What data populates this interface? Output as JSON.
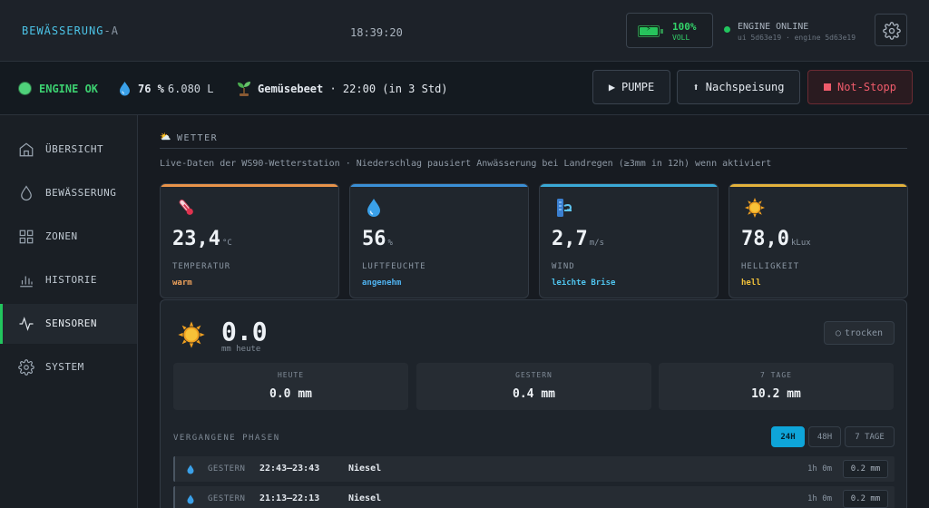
{
  "header": {
    "brand": "BEWÄSSERUNG",
    "brand_suffix": "-A",
    "clock": "18:39:20",
    "battery": {
      "percent": "100%",
      "label": "VOLL",
      "level": 1.0,
      "color": "#27c35c"
    },
    "engine": {
      "status": "ENGINE ONLINE",
      "versions": "ui 5d63e19 · engine 5d63e19",
      "color": "#22c55e"
    },
    "settings_icon": "gear-icon"
  },
  "statusbar": {
    "engine_ok": "ENGINE OK",
    "tank_percent": "76 %",
    "tank_volume": "6.080 L",
    "schedule_zone": "Gemüsebeet",
    "schedule_time": "· 22:00 (in 3 Std)",
    "pump_button": "PUMPE",
    "refill_button": "Nachspeisung",
    "stop_button": "Not-Stopp"
  },
  "sidebar": {
    "items": [
      {
        "label": "ÜBERSICHT",
        "icon": "home-icon",
        "active": false
      },
      {
        "label": "BEWÄSSERUNG",
        "icon": "drop-icon",
        "active": false
      },
      {
        "label": "ZONEN",
        "icon": "grid-icon",
        "active": false
      },
      {
        "label": "HISTORIE",
        "icon": "bar-chart-icon",
        "active": false
      },
      {
        "label": "SENSOREN",
        "icon": "pulse-icon",
        "active": true
      },
      {
        "label": "SYSTEM",
        "icon": "gear-icon",
        "active": false
      }
    ]
  },
  "weather": {
    "title": "WETTER",
    "description": "Live-Daten der WS90-Wetterstation · Niederschlag pausiert Anwässerung bei Landregen (≥3mm in 12h) wenn aktiviert",
    "cards": [
      {
        "value": "23,4",
        "unit": "°C",
        "label": "TEMPERATUR",
        "state": "warm",
        "icon": "thermometer-icon",
        "accent": "#e8934a",
        "state_color": "#f0a35c"
      },
      {
        "value": "56",
        "unit": "%",
        "label": "LUFTFEUCHTE",
        "state": "angenehm",
        "icon": "droplet-icon",
        "accent": "#3a8fd6",
        "state_color": "#4fb3f0"
      },
      {
        "value": "2,7",
        "unit": "m/s",
        "label": "WIND",
        "state": "leichte Brise",
        "icon": "wind-icon",
        "accent": "#3aa9d6",
        "state_color": "#4fc4ee"
      },
      {
        "value": "78,0",
        "unit": "kLux",
        "label": "HELLIGKEIT",
        "state": "hell",
        "icon": "sun-icon",
        "accent": "#e3b23c",
        "state_color": "#f2c23a"
      }
    ]
  },
  "rain": {
    "value": "0.0",
    "sub": "mm heute",
    "badge": "trocken",
    "stats": [
      {
        "label": "HEUTE",
        "value": "0.0 mm"
      },
      {
        "label": "GESTERN",
        "value": "0.4 mm"
      },
      {
        "label": "7 TAGE",
        "value": "10.2 mm"
      }
    ],
    "phases_title": "VERGANGENE PHASEN",
    "tabs": [
      {
        "label": "24H",
        "active": true
      },
      {
        "label": "48H",
        "active": false
      },
      {
        "label": "7 TAGE",
        "active": false
      }
    ],
    "phases": [
      {
        "day": "GESTERN",
        "time": "22:43–23:43",
        "type": "Niesel",
        "duration": "1h 0m",
        "amount": "0.2 mm"
      },
      {
        "day": "GESTERN",
        "time": "21:13–22:13",
        "type": "Niesel",
        "duration": "1h 0m",
        "amount": "0.2 mm"
      }
    ]
  }
}
